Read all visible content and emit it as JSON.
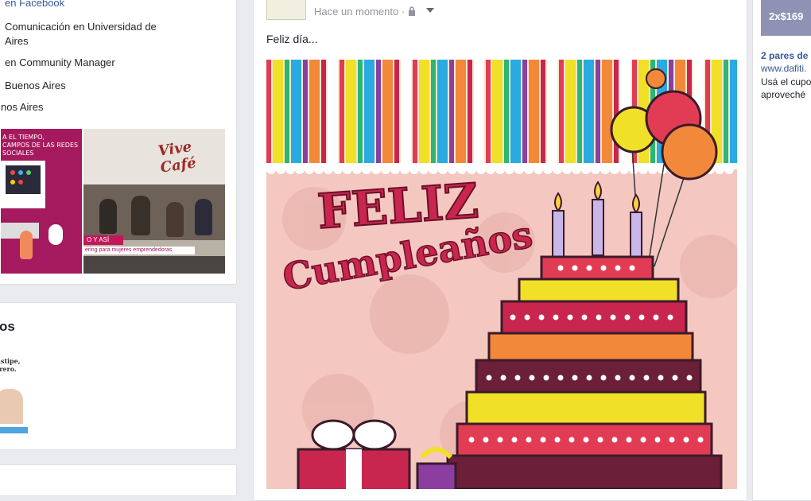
{
  "left": {
    "intro_items": [
      {
        "text": "en Facebook"
      },
      {
        "text": "Comunicación en Universidad de"
      },
      {
        "text": "Aires"
      },
      {
        "text": "en Community Manager"
      },
      {
        "text": "Buenos Aires"
      },
      {
        "text": "nos Aires"
      }
    ],
    "photos": {
      "photo1_lines": [
        "A EL TIEMPO,",
        "CAMPOS DE LAS REDES SOCIALES"
      ],
      "photo2_sign": "Vive Café",
      "photo2_banner": "O Y ASÍ",
      "photo2_caption": "ering para mujeres emprendedoras"
    },
    "friends_title": "os",
    "friend_thumb_text": "nstipe, rrero."
  },
  "post": {
    "timestamp": "Hace un momento",
    "separator": " · ",
    "text": "Feliz día...",
    "image": {
      "line1": "FELIZ",
      "line2": "Cumpleaños"
    }
  },
  "ad": {
    "thumb_text": "2x$169",
    "title": "2 pares de",
    "url": "www.dafiti.",
    "desc1": "Usá el cupo",
    "desc2": "aproveché"
  },
  "colors": {
    "link": "#365899",
    "meta_gray": "#90949c",
    "page_bg": "#e9ebee",
    "card_text": "#1d2129"
  },
  "icons": [
    "lock-icon",
    "chevron-down-icon"
  ]
}
